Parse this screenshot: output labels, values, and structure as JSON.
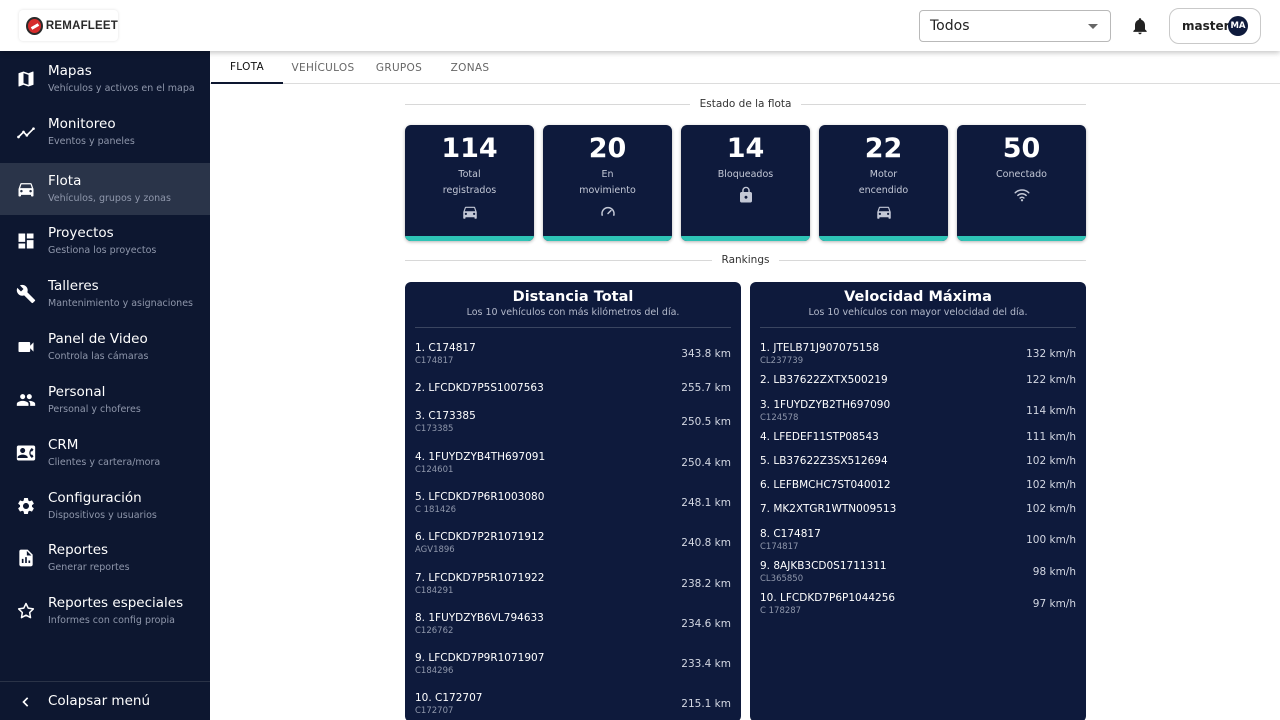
{
  "header": {
    "logo_text": "REMAFLEET",
    "select_value": "Todos",
    "user_name": "master",
    "user_initials": "MA"
  },
  "sidebar": {
    "items": [
      {
        "title": "Mapas",
        "subtitle": "Vehículos y activos en el mapa",
        "icon": "map-icon"
      },
      {
        "title": "Monitoreo",
        "subtitle": "Eventos y paneles",
        "icon": "chart-line-icon"
      },
      {
        "title": "Flota",
        "subtitle": "Vehículos, grupos y zonas",
        "icon": "car-icon"
      },
      {
        "title": "Proyectos",
        "subtitle": "Gestiona los proyectos",
        "icon": "dashboard-icon"
      },
      {
        "title": "Talleres",
        "subtitle": "Mantenimiento y asignaciones",
        "icon": "wrench-icon"
      },
      {
        "title": "Panel de Video",
        "subtitle": "Controla las cámaras",
        "icon": "video-camera-icon"
      },
      {
        "title": "Personal",
        "subtitle": "Personal y choferes",
        "icon": "people-icon"
      },
      {
        "title": "CRM",
        "subtitle": "Clientes y cartera/mora",
        "icon": "contact-card-icon"
      },
      {
        "title": "Configuración",
        "subtitle": "Dispositivos y usuarios",
        "icon": "gear-icon"
      },
      {
        "title": "Reportes",
        "subtitle": "Generar reportes",
        "icon": "report-icon"
      },
      {
        "title": "Reportes especiales",
        "subtitle": "Informes con config propia",
        "icon": "star-icon"
      }
    ],
    "active_index": 2,
    "collapse_label": "Colapsar menú"
  },
  "tabs": [
    "FLOTA",
    "VEHÍCULOS",
    "GRUPOS",
    "ZONAS"
  ],
  "fleet_status": {
    "section_title": "Estado de la flota",
    "cards": [
      {
        "value": "114",
        "label_1": "Total",
        "label_2": "registrados",
        "icon": "car-icon"
      },
      {
        "value": "20",
        "label_1": "En",
        "label_2": "movimiento",
        "icon": "speedometer-icon"
      },
      {
        "value": "14",
        "label_1": "Bloqueados",
        "label_2": "",
        "icon": "lock-icon"
      },
      {
        "value": "22",
        "label_1": "Motor",
        "label_2": "encendido",
        "icon": "car-icon"
      },
      {
        "value": "50",
        "label_1": "Conectado",
        "label_2": "",
        "icon": "wifi-icon"
      }
    ]
  },
  "rankings": {
    "section_title": "Rankings",
    "distance": {
      "title": "Distancia Total",
      "subtitle": "Los 10 vehículos con más kilómetros del día.",
      "rows": [
        {
          "name": "1. C174817",
          "sub": "C174817",
          "value": "343.8 km"
        },
        {
          "name": "2. LFCDKD7P5S1007563",
          "sub": "",
          "value": "255.7 km"
        },
        {
          "name": "3. C173385",
          "sub": "C173385",
          "value": "250.5 km"
        },
        {
          "name": "4. 1FUYDZYB4TH697091",
          "sub": "C124601",
          "value": "250.4 km"
        },
        {
          "name": "5. LFCDKD7P6R1003080",
          "sub": "C 181426",
          "value": "248.1 km"
        },
        {
          "name": "6. LFCDKD7P2R1071912",
          "sub": "AGV1896",
          "value": "240.8 km"
        },
        {
          "name": "7. LFCDKD7P5R1071922",
          "sub": "C184291",
          "value": "238.2 km"
        },
        {
          "name": "8. 1FUYDZYB6VL794633",
          "sub": "C126762",
          "value": "234.6 km"
        },
        {
          "name": "9. LFCDKD7P9R1071907",
          "sub": "C184296",
          "value": "233.4 km"
        },
        {
          "name": "10. C172707",
          "sub": "C172707",
          "value": "215.1 km"
        }
      ]
    },
    "speed": {
      "title": "Velocidad Máxima",
      "subtitle": "Los 10 vehículos con mayor velocidad del día.",
      "rows": [
        {
          "name": "1. JTELB71J907075158",
          "sub": "CL237739",
          "value": "132 km/h"
        },
        {
          "name": "2. LB37622ZXTX500219",
          "sub": "",
          "value": "122 km/h"
        },
        {
          "name": "3. 1FUYDZYB2TH697090",
          "sub": "C124578",
          "value": "114 km/h"
        },
        {
          "name": "4. LFEDEF11STP08543",
          "sub": "",
          "value": "111 km/h"
        },
        {
          "name": "5. LB37622Z3SX512694",
          "sub": "",
          "value": "102 km/h"
        },
        {
          "name": "6. LEFBMCHC7ST040012",
          "sub": "",
          "value": "102 km/h"
        },
        {
          "name": "7. MK2XTGR1WTN009513",
          "sub": "",
          "value": "102 km/h"
        },
        {
          "name": "8. C174817",
          "sub": "C174817",
          "value": "100 km/h"
        },
        {
          "name": "9. 8AJKB3CD0S1711311",
          "sub": "CL365850",
          "value": "98 km/h"
        },
        {
          "name": "10. LFCDKD7P6P1044256",
          "sub": "C 178287",
          "value": "97 km/h"
        }
      ]
    }
  },
  "colors": {
    "sidebar_bg": "#0d1730",
    "sidebar_active": "#2a3449",
    "card_bg": "#0e1a3c",
    "accent": "#2ec4b6"
  }
}
